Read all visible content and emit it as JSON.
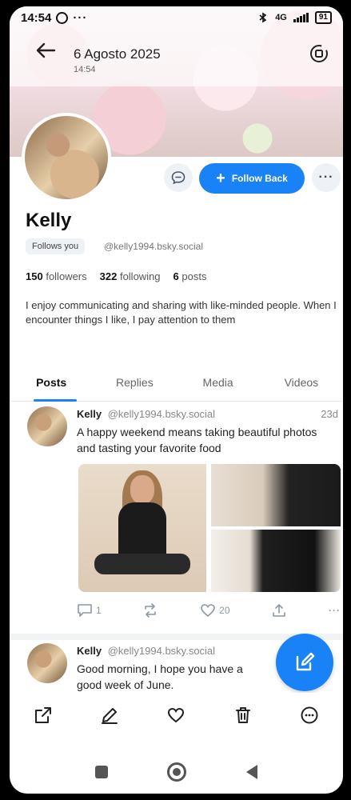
{
  "status_bar": {
    "time": "14:54",
    "dots": "···",
    "network": "4G",
    "battery": "91"
  },
  "header": {
    "title": "6 Agosto 2025",
    "subtitle": "14:54"
  },
  "profile": {
    "name": "Kelly",
    "follows_you": "Follows you",
    "handle": "@kelly1994.bsky.social",
    "followers_count": "150",
    "followers_label": "followers",
    "following_count": "322",
    "following_label": "following",
    "posts_count": "6",
    "posts_label": "posts",
    "bio": "I enjoy communicating and sharing with like-minded people. When I encounter things I like, I pay attention to them",
    "follow_back_label": "Follow Back",
    "more_label": "···"
  },
  "tabs": [
    "Posts",
    "Replies",
    "Media",
    "Videos"
  ],
  "posts": [
    {
      "author": "Kelly",
      "handle": "@kelly1994.bsky.social",
      "time": "23d",
      "text": "A happy weekend means taking beautiful photos and tasting your favorite food",
      "replies": "1",
      "likes": "20"
    },
    {
      "author": "Kelly",
      "handle": "@kelly1994.bsky.social",
      "text": "Good morning, I hope you have a good week of June."
    }
  ],
  "colors": {
    "accent": "#1a82f7",
    "muted": "#8a98a8"
  }
}
